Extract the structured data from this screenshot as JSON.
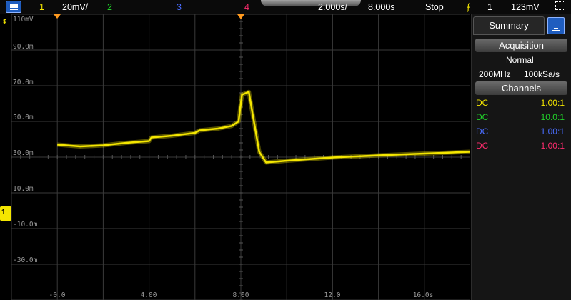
{
  "topbar": {
    "ch1_num": "1",
    "ch1_scale": "20mV/",
    "ch2_num": "2",
    "ch3_num": "3",
    "ch4_num": "4",
    "time_scale": "2.000s/",
    "time_delay": "8.000s",
    "run_state": "Stop",
    "trigger_channel": "1",
    "trigger_level": "123mV"
  },
  "y_labels": [
    "110mV",
    "90.0m",
    "70.0m",
    "50.0m",
    "30.0m",
    "10.0m",
    "-10.0m",
    "-30.0m"
  ],
  "x_labels": [
    "-0.0",
    "4.00",
    "8.00",
    "12.0",
    "16.0s"
  ],
  "ch1_marker": "1",
  "waveform": {
    "color": "#f4e600",
    "unit_x": "s",
    "unit_y": "mV",
    "points": [
      [
        -0.0,
        37.0
      ],
      [
        1.0,
        36.0
      ],
      [
        2.0,
        36.6
      ],
      [
        3.0,
        38.0
      ],
      [
        4.0,
        39.0
      ],
      [
        4.1,
        41.0
      ],
      [
        5.0,
        42.0
      ],
      [
        6.0,
        43.6
      ],
      [
        6.2,
        45.0
      ],
      [
        7.0,
        46.0
      ],
      [
        7.6,
        47.5
      ],
      [
        7.9,
        50.0
      ],
      [
        8.05,
        65.0
      ],
      [
        8.35,
        66.5
      ],
      [
        8.5,
        55.0
      ],
      [
        8.8,
        33.0
      ],
      [
        9.1,
        27.0
      ],
      [
        10.0,
        28.0
      ],
      [
        12.0,
        29.8
      ],
      [
        14.0,
        31.0
      ],
      [
        16.0,
        32.0
      ],
      [
        18.0,
        33.0
      ],
      [
        18.2,
        33.0
      ]
    ]
  },
  "panel": {
    "tab_label": "Summary",
    "acquisition_header": "Acquisition",
    "acq_mode": "Normal",
    "bandwidth": "200MHz",
    "sample_rate": "100kSa/s",
    "channels_header": "Channels",
    "channels": [
      {
        "coupling": "DC",
        "probe": "1.00:1",
        "color": "#f4e600"
      },
      {
        "coupling": "DC",
        "probe": "10.0:1",
        "color": "#21d22a"
      },
      {
        "coupling": "DC",
        "probe": "1.00:1",
        "color": "#4a6dff"
      },
      {
        "coupling": "DC",
        "probe": "1.00:1",
        "color": "#ff2c6e"
      }
    ]
  }
}
